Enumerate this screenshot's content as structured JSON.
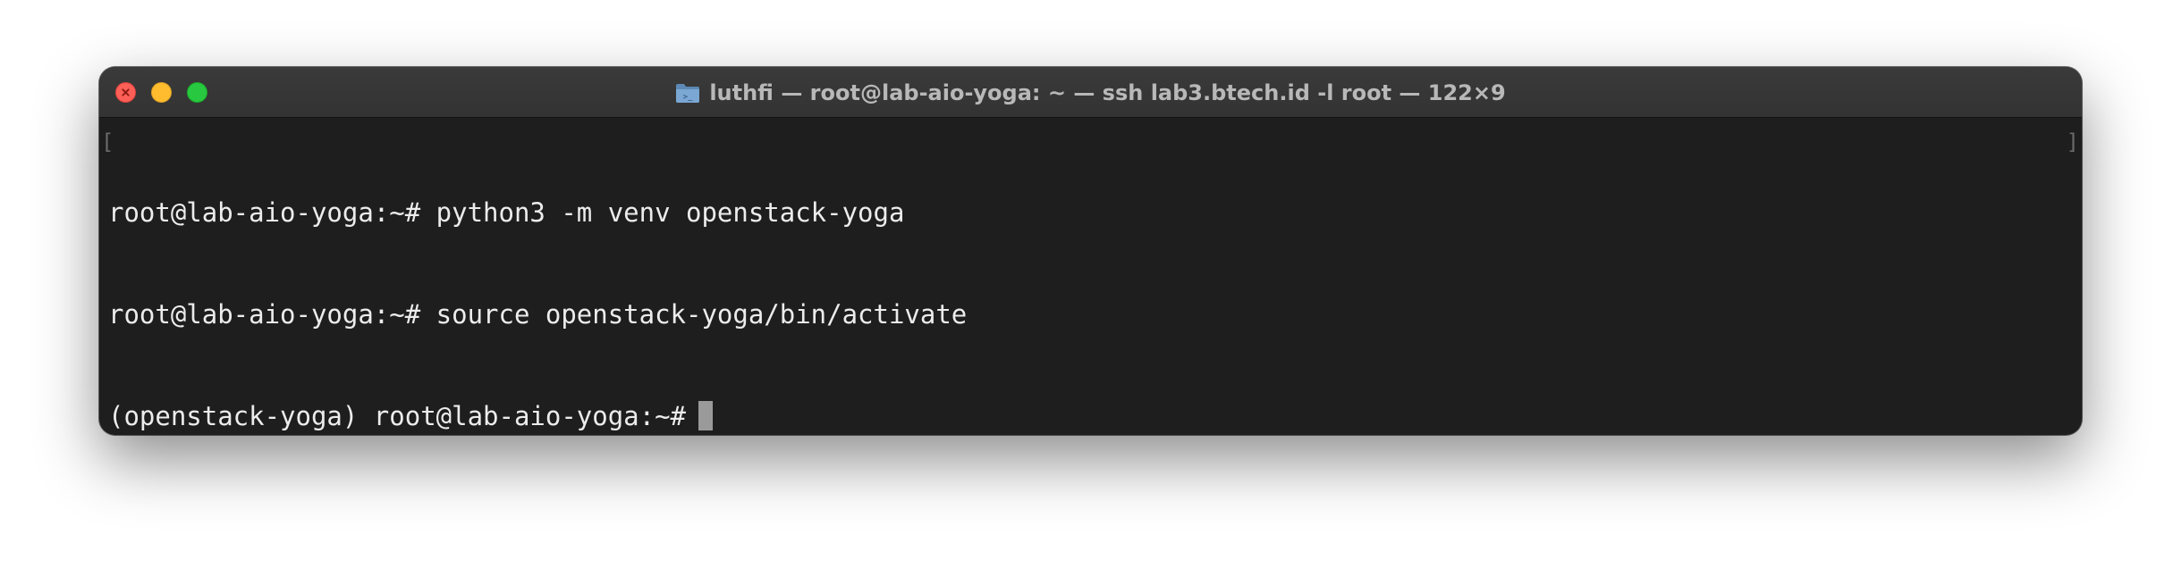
{
  "window": {
    "title": "luthfi — root@lab-aio-yoga: ~ — ssh lab3.btech.id -l root — 122×9",
    "title_icon": "folder-icon",
    "traffic_lights": {
      "close": "#fe5f57",
      "minimize": "#febc2e",
      "zoom": "#28c840"
    }
  },
  "terminal": {
    "background": "#1e1e1e",
    "text_color": "#ececec",
    "bracket_left": "[",
    "bracket_right": "]",
    "lines": [
      "root@lab-aio-yoga:~# python3 -m venv openstack-yoga",
      "root@lab-aio-yoga:~# source openstack-yoga/bin/activate",
      "(openstack-yoga) root@lab-aio-yoga:~#"
    ]
  }
}
